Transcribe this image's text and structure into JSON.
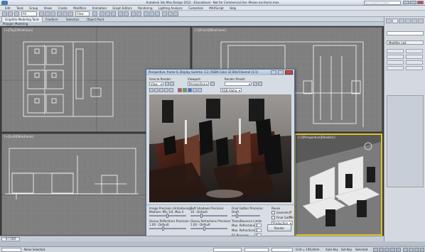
{
  "app": {
    "window_title": "Autodesk 3ds Max Design 2012 · Educational · Not for Commercial Use    ·Mesas escritorio.max",
    "search_placeholder": "Type a keyword or phrase"
  },
  "menu": [
    "Edit",
    "Tools",
    "Group",
    "Views",
    "Create",
    "Modifiers",
    "Animation",
    "Graph Editors",
    "Rendering",
    "Lighting Analysis",
    "Customize",
    "MAXScript",
    "Help"
  ],
  "toolbar": {
    "selection_filter": "All",
    "view_dropdown": "View"
  },
  "ribbon": {
    "tabs": [
      "Graphite Modeling Tools",
      "Freeform",
      "Selection",
      "Object Paint"
    ],
    "sub": "Polygon Modeling"
  },
  "viewports": {
    "top": "[+][Top][Wireframe]",
    "front": "[+][Front][Wireframe]",
    "left": "[+][Left][Wireframe]",
    "perspective": "[+][Perspective][Realistic]"
  },
  "command_panel": {
    "modifier_list": "Modifier List"
  },
  "render_frame": {
    "title": "Perspective, frame 0, Display Gamma: 2.2, RGBA Color 32 Bits/Channel (1:1)",
    "area_label": "Area to Render:",
    "area_value": "View",
    "viewport_label": "Viewport:",
    "viewport_value": "Perspective",
    "preset_label": "Render Preset:",
    "preset_value": "",
    "channel_value": "RGB Alpha",
    "image_precision_label": "Image Precision (Antialiasing):",
    "image_precision_value": "Medium: Min 1/4, Max 4",
    "soft_shadows_label": "Soft Shadows Precision:",
    "soft_shadows_value": "1X - Default",
    "final_gather_label": "Final Gather Precision:",
    "final_gather_value": "Draft",
    "reuse_label": "Reuse",
    "geometry_label": "Geometry",
    "final_gather_reuse_label": "Final Gather",
    "glossy_reflections_label": "Glossy Reflections Precision:",
    "glossy_reflections_value": "1.0X - Default",
    "glossy_refractions_label": "Glossy Refractions Precision:",
    "glossy_refractions_value": "1.0X - Default",
    "trace_label": "Trace/Bounces Limits",
    "max_reflections_label": "Max. Reflections:",
    "max_reflections_value": "4",
    "max_refractions_label": "Max. Refractions:",
    "max_refractions_value": "6",
    "fg_bounces_label": "FG Bounces:",
    "fg_bounces_value": "0",
    "mode_value": "Production",
    "render_button": "Render"
  },
  "timeline": {
    "frame": "0 / 100"
  },
  "status": {
    "selection": "None Selected",
    "grid": "Grid = 100,0mm",
    "auto_key": "Auto Key",
    "set_key": "Set Key",
    "selected": "Selected"
  }
}
